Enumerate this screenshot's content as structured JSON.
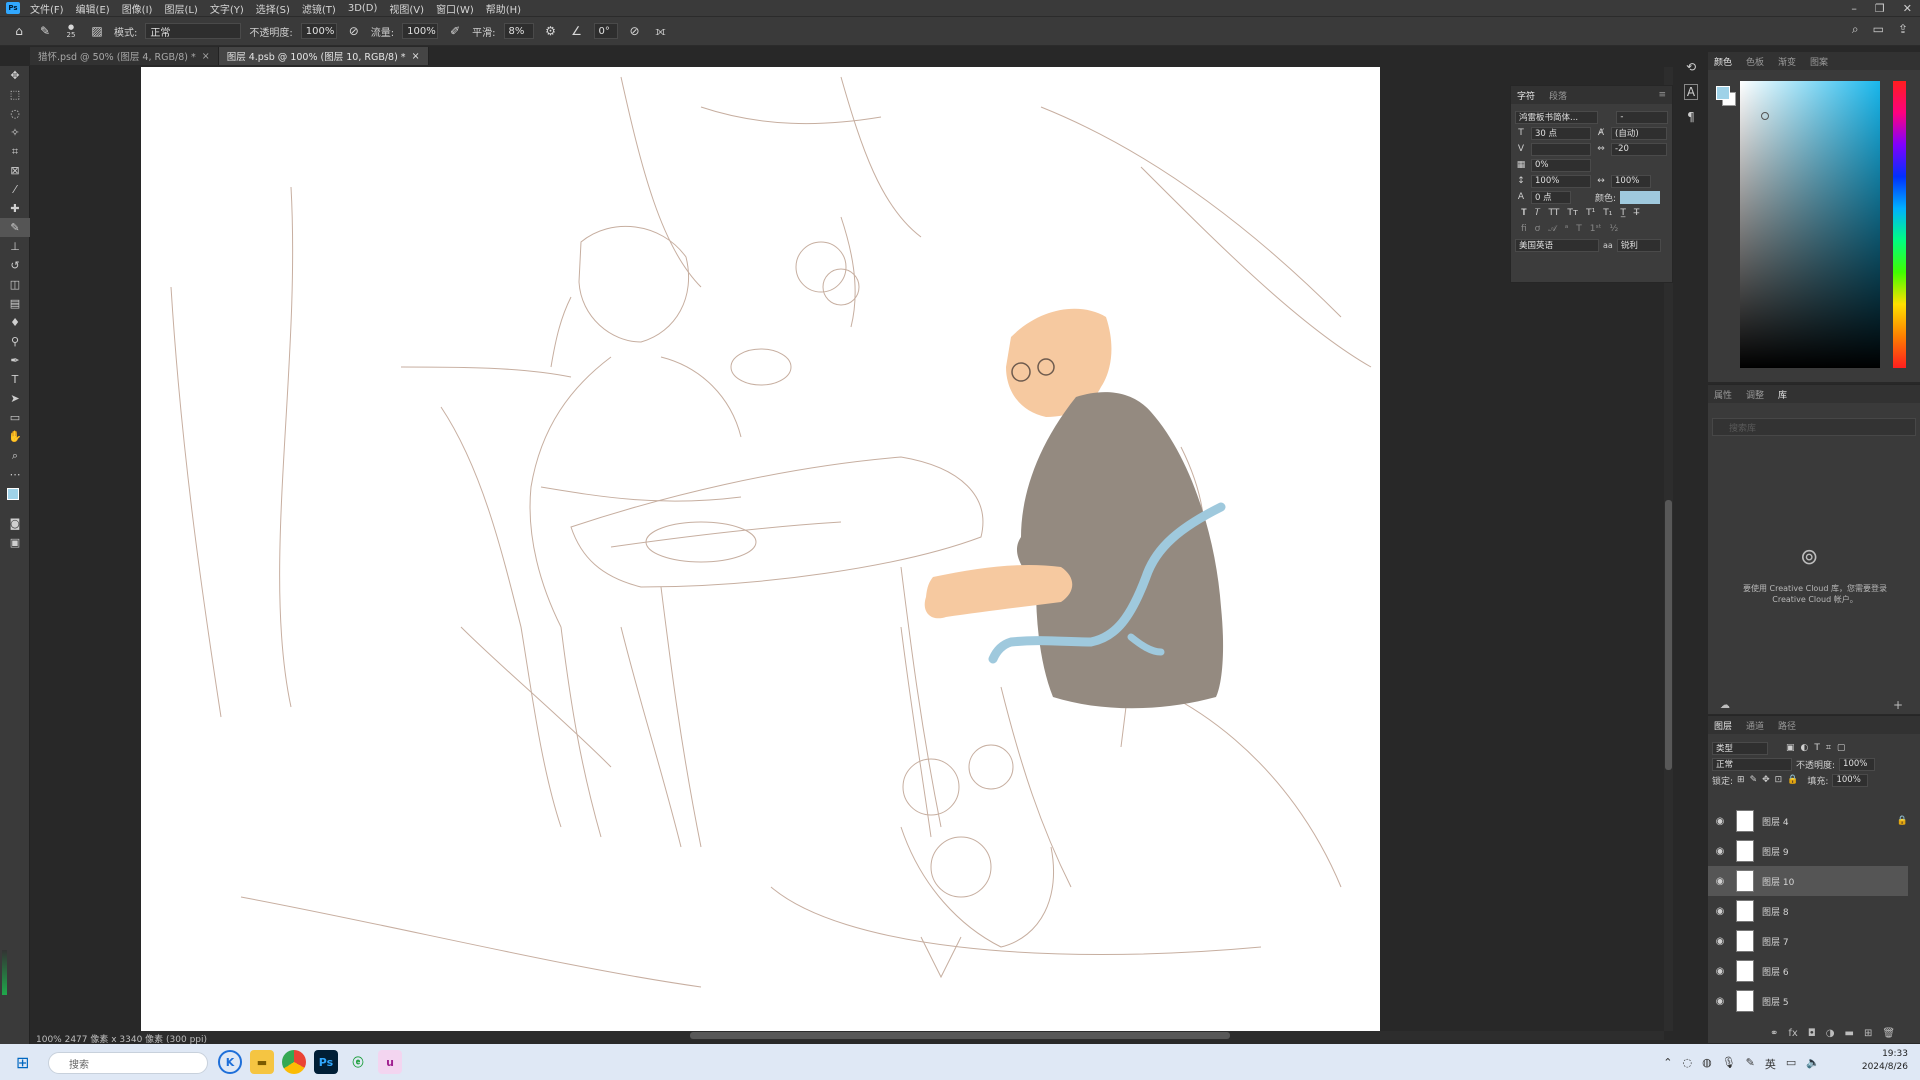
{
  "menubar": {
    "items": [
      "文件(F)",
      "编辑(E)",
      "图像(I)",
      "图层(L)",
      "文字(Y)",
      "选择(S)",
      "滤镜(T)",
      "3D(D)",
      "视图(V)",
      "窗口(W)",
      "帮助(H)"
    ]
  },
  "options": {
    "brush_size": "25",
    "mode_label": "模式:",
    "mode_value": "正常",
    "opacity_label": "不透明度:",
    "opacity_value": "100%",
    "flow_label": "流量:",
    "flow_value": "100%",
    "smooth_label": "平滑:",
    "smooth_value": "8%",
    "angle_value": "0°"
  },
  "tabs": [
    {
      "label": "猎怀.psd @ 50% (图层 4, RGB/8) *"
    },
    {
      "label": "图层 4.psb @ 100% (图层 10, RGB/8) *"
    }
  ],
  "status": {
    "text": "100%    2477 像素 x 3340 像素 (300 ppi)"
  },
  "char_panel": {
    "tabs": [
      "字符",
      "段落"
    ],
    "font_family": "鸿雷板书简体...",
    "font_style": "-",
    "size": "30 点",
    "leading": "(自动)",
    "kerning": "",
    "tracking": "-20",
    "scale_pct": "0%",
    "vscale": "100%",
    "hscale": "100%",
    "baseline": "0 点",
    "color_label": "颜色:",
    "color": "#9fc9dd",
    "language": "美国英语",
    "aa_label": "aa",
    "aa_value": "锐利"
  },
  "color_panel": {
    "tabs": [
      "颜色",
      "色板",
      "渐变",
      "图案"
    ],
    "foreground": "#9fd2e8",
    "background": "#ffffff"
  },
  "lib_panel": {
    "tabs": [
      "属性",
      "调整",
      "库"
    ],
    "search_placeholder": "搜索库",
    "message": "要使用 Creative Cloud 库，您需要登录 Creative Cloud 帐户。"
  },
  "layers_panel": {
    "tabs": [
      "图层",
      "通道",
      "路径"
    ],
    "kind_label": "类型",
    "blend_mode": "正常",
    "opacity_label": "不透明度:",
    "opacity_value": "100%",
    "lock_label": "锁定:",
    "fill_label": "填充:",
    "fill_value": "100%",
    "layers": [
      {
        "name": "图层 4"
      },
      {
        "name": "图层 9"
      },
      {
        "name": "图层 10"
      },
      {
        "name": "图层 8"
      },
      {
        "name": "图层 7"
      },
      {
        "name": "图层 6"
      },
      {
        "name": "图层 5"
      }
    ]
  },
  "taskbar": {
    "search_placeholder": "搜索",
    "time": "19:33",
    "date": "2024/8/26"
  },
  "colors": {
    "ui_bg": "#282828",
    "panel": "#3a3a3a",
    "sketch": "#b49380",
    "skin": "#f6c9a0",
    "shirt": "#948a80",
    "chair": "#9fc9dd"
  }
}
